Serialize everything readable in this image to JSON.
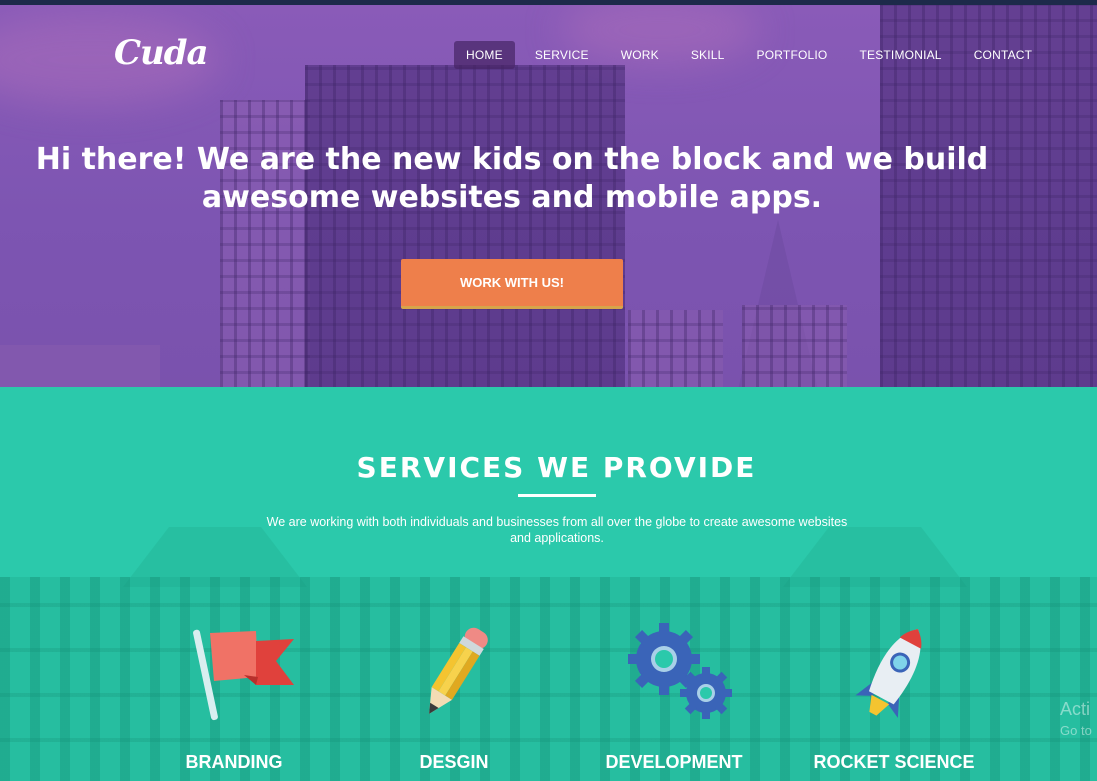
{
  "brand": {
    "logo": "Cuda"
  },
  "nav": {
    "items": [
      {
        "label": "HOME",
        "active": true
      },
      {
        "label": "SERVICE",
        "active": false
      },
      {
        "label": "WORK",
        "active": false
      },
      {
        "label": "SKILL",
        "active": false
      },
      {
        "label": "PORTFOLIO",
        "active": false
      },
      {
        "label": "TESTIMONIAL",
        "active": false
      },
      {
        "label": "CONTACT",
        "active": false
      }
    ]
  },
  "hero": {
    "line1": "Hi there! We are the new kids on the block and we build",
    "line2": "awesome websites and mobile apps.",
    "cta_label": "WORK WITH US!"
  },
  "services": {
    "title": "SERVICES WE PROVIDE",
    "desc_line1": "We are working with both individuals and businesses from all over the globe to create awesome websites",
    "desc_line2": "and applications.",
    "items": [
      {
        "label": "BRANDING",
        "icon": "flag-icon"
      },
      {
        "label": "DESGIN",
        "icon": "pencil-icon"
      },
      {
        "label": "DEVELOPMENT",
        "icon": "gears-icon"
      },
      {
        "label": "ROCKET SCIENCE",
        "icon": "rocket-icon"
      }
    ]
  },
  "watermark": {
    "line1": "Acti",
    "line2": "Go to"
  },
  "colors": {
    "hero_overlay": "#7d55b2",
    "services_bg": "#2bc9ab",
    "cta": "#ee7f4b",
    "nav_active": "#46236499"
  }
}
